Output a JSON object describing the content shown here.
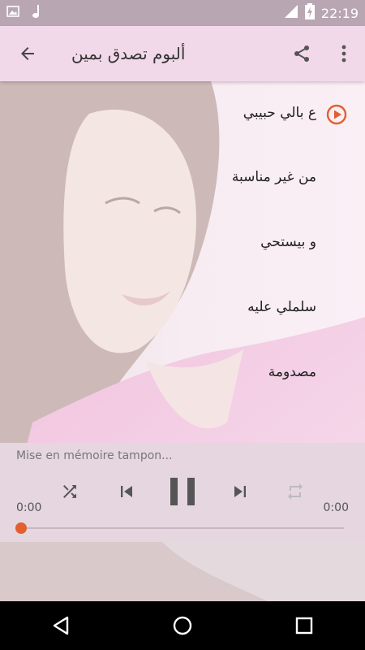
{
  "status_bar": {
    "time": "22:19",
    "icons": [
      "image-icon",
      "music-note-icon",
      "wifi-icon",
      "battery-charging-icon"
    ]
  },
  "app_bar": {
    "title": "ألبوم تصدق بمين",
    "back_icon": "arrow-left-icon",
    "share_icon": "share-icon",
    "menu_icon": "more-vert-icon"
  },
  "tracks": [
    {
      "title": "ع بالي حبيبي",
      "playing": true
    },
    {
      "title": "من غير مناسبة",
      "playing": false
    },
    {
      "title": "و بيستحي",
      "playing": false
    },
    {
      "title": "سلملي عليه",
      "playing": false
    },
    {
      "title": "مصدومة",
      "playing": false
    }
  ],
  "player": {
    "status": "Mise en mémoire tampon...",
    "current_time": "0:00",
    "duration": "0:00",
    "progress": 0,
    "icons": [
      "shuffle-icon",
      "skip-previous-icon",
      "pause-icon",
      "skip-next-icon",
      "repeat-icon"
    ]
  },
  "colors": {
    "status_bar": "#b9a6b3",
    "app_bar": "#f2d9ea",
    "accent": "#e25f2f",
    "nav_bar": "#000000"
  },
  "nav_bar": {
    "icons": [
      "back-triangle-icon",
      "home-circle-icon",
      "recents-square-icon"
    ]
  }
}
